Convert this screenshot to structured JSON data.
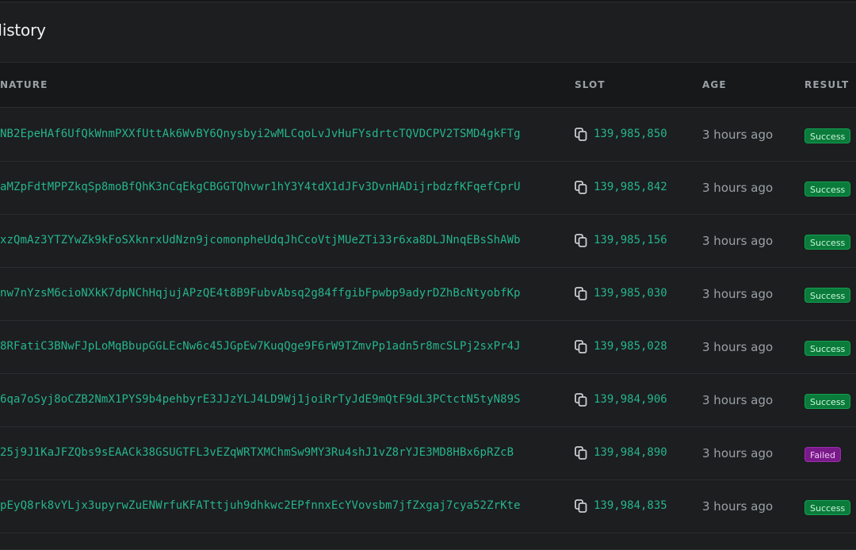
{
  "panel": {
    "title": "History"
  },
  "columns": {
    "signature": "NATURE",
    "slot": "SLOT",
    "age": "AGE",
    "result": "RESULT"
  },
  "colors": {
    "link": "#26b58e",
    "success": "#0a7b3b",
    "failed": "#7a1a8a"
  },
  "rows": [
    {
      "signature": "NB2EpeHAf6UfQkWnmPXXfUttAk6WvBY6Qnysbyi2wMLCqoLvJvHuFYsdrtcTQVDCPV2TSMD4gkFTg",
      "slot": "139,985,850",
      "age": "3 hours ago",
      "result": "Success",
      "status": "success"
    },
    {
      "signature": "aMZpFdtMPPZkqSp8moBfQhK3nCqEkgCBGGTQhvwr1hY3Y4tdX1dJFv3DvnHADijrbdzfKFqefCprU",
      "slot": "139,985,842",
      "age": "3 hours ago",
      "result": "Success",
      "status": "success"
    },
    {
      "signature": "xzQmAz3YTZYwZk9kFoSXknrxUdNzn9jcomonpheUdqJhCcoVtjMUeZTi33r6xa8DLJNnqEBsShAWb",
      "slot": "139,985,156",
      "age": "3 hours ago",
      "result": "Success",
      "status": "success"
    },
    {
      "signature": "nw7nYzsM6cioNXkK7dpNChHqjujAPzQE4t8B9FubvAbsq2g84ffgibFpwbp9adyrDZhBcNtyobfKp",
      "slot": "139,985,030",
      "age": "3 hours ago",
      "result": "Success",
      "status": "success"
    },
    {
      "signature": "8RFatiC3BNwFJpLoMqBbupGGLEcNw6c45JGpEw7KuqQge9F6rW9TZmvPp1adn5r8mcSLPj2sxPr4J",
      "slot": "139,985,028",
      "age": "3 hours ago",
      "result": "Success",
      "status": "success"
    },
    {
      "signature": "6qa7oSyj8oCZB2NmX1PYS9b4pehbyrE3JJzYLJ4LD9Wj1joiRrTyJdE9mQtF9dL3PCtctN5tyN89S",
      "slot": "139,984,906",
      "age": "3 hours ago",
      "result": "Success",
      "status": "success"
    },
    {
      "signature": "25j9J1KaJFZQbs9sEAACk38GSUGTFL3vEZqWRTXMChmSw9MY3Ru4shJ1vZ8rYJE3MD8HBx6pRZcB",
      "slot": "139,984,890",
      "age": "3 hours ago",
      "result": "Failed",
      "status": "failed"
    },
    {
      "signature": "pEyQ8rk8vYLjx3upyrwZuENWrfuKFATttjuh9dhkwc2EPfnnxEcYVovsbm7jfZxgaj7cya52ZrKte",
      "slot": "139,984,835",
      "age": "3 hours ago",
      "result": "Success",
      "status": "success"
    }
  ]
}
